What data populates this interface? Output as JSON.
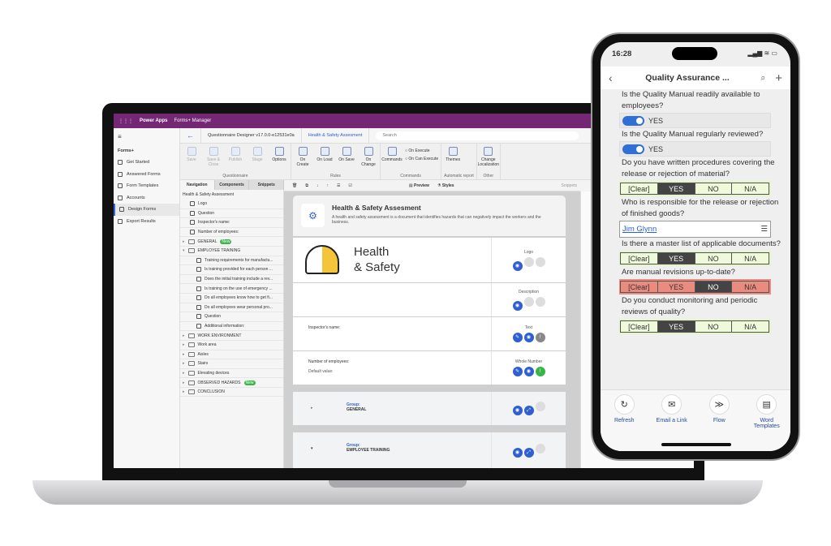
{
  "laptop": {
    "app_name": "Power Apps",
    "app_section": "Forms+ Manager",
    "nav_title": "Forms+",
    "nav_items": [
      {
        "label": "Get Started"
      },
      {
        "label": "Answered Forms"
      },
      {
        "label": "Form Templates"
      },
      {
        "label": "Accounts"
      },
      {
        "label": "Design Forms",
        "active": true
      },
      {
        "label": "Export Results"
      }
    ],
    "header": {
      "designer": "Questionnaire Designer v17.0.0-e12531e0a",
      "form": "Health & Safety Assesment",
      "search_placeholder": "Search"
    },
    "ribbon": {
      "questionnaire": {
        "label": "Questionnaire",
        "buttons": [
          "Save",
          "Save & Close",
          "Publish",
          "Stage",
          "Options"
        ]
      },
      "rules": {
        "label": "Rules",
        "buttons": [
          "On Create",
          "On Load",
          "On Save",
          "On Change"
        ]
      },
      "commands": {
        "label": "Commands",
        "buttons": [
          "Commands"
        ],
        "options": [
          "On Execute",
          "On Can Execute"
        ]
      },
      "automatic_report": {
        "label": "Automatic report",
        "buttons": [
          "Themes"
        ]
      },
      "other": {
        "label": "Other",
        "buttons": [
          "Change Localization"
        ]
      }
    },
    "tabs": [
      "Navigation",
      "Components",
      "Snippets"
    ],
    "toolbar": {
      "preview": "Preview",
      "styles": "Styles",
      "snippets": "Snippets"
    },
    "tree": {
      "root": "Health & Safety Assessment",
      "items": [
        {
          "label": "Logo",
          "level": 1
        },
        {
          "label": "Question",
          "level": 1
        },
        {
          "label": "Inspector's name:",
          "level": 1
        },
        {
          "label": "Number of employees:",
          "level": 1
        },
        {
          "label": "GENERAL",
          "level": 0,
          "badge": "New"
        },
        {
          "label": "EMPLOYEE TRAINING",
          "level": 0,
          "expanded": true
        },
        {
          "label": "Training requirements for manufactu...",
          "level": 2
        },
        {
          "label": "Is training provided for each person ...",
          "level": 2
        },
        {
          "label": "Does the initial training include a rev...",
          "level": 2
        },
        {
          "label": "Is training on the use of emergency ...",
          "level": 2
        },
        {
          "label": "Do all employees know how to get fi...",
          "level": 2
        },
        {
          "label": "Do all employees wear personal pro...",
          "level": 2
        },
        {
          "label": "Question",
          "level": 2
        },
        {
          "label": "Additional information:",
          "level": 2
        },
        {
          "label": "WORK ENVIRONMENT",
          "level": 0
        },
        {
          "label": "Work area",
          "level": 0
        },
        {
          "label": "Aisles",
          "level": 0
        },
        {
          "label": "Stairs",
          "level": 0
        },
        {
          "label": "Elevating devices",
          "level": 0
        },
        {
          "label": "OBSERVED HAZARDS",
          "level": 0,
          "badge": "New"
        },
        {
          "label": "CONCLUSION",
          "level": 0
        }
      ]
    },
    "form": {
      "title": "Health & Safety Assesment",
      "description": "A health and safety assessment is a document that identifies hazards that can negatively impact the workers and the business.",
      "logo_line1": "Health",
      "logo_line2": "& Safety",
      "rows": [
        {
          "type": "Logo"
        },
        {
          "type": "Description"
        },
        {
          "label": "Inspector's name:",
          "type": "Text"
        },
        {
          "label": "Number of employees:",
          "sub": "Default value:",
          "type": "Whole Number"
        }
      ],
      "groups": [
        {
          "prefix": "Group:",
          "name": "GENERAL"
        },
        {
          "prefix": "Group:",
          "name": "EMPLOYEE TRAINING"
        }
      ]
    }
  },
  "phone": {
    "time": "16:28",
    "title": "Quality Assurance ...",
    "questions": [
      {
        "text": "Is the Quality Manual readily available to employees?",
        "kind": "toggle",
        "value": "YES"
      },
      {
        "text": "Is the Quality Manual regularly reviewed?",
        "kind": "toggle",
        "value": "YES"
      },
      {
        "text": "Do you have written procedures covering the release or rejection of material?",
        "kind": "choice",
        "value": "YES"
      },
      {
        "text": "Who is responsible for the release or rejection of finished goods?",
        "kind": "lookup",
        "value": "Jim Glynn"
      },
      {
        "text": "Is there a master list of applicable documents?",
        "kind": "choice",
        "value": "YES"
      },
      {
        "text": "Are manual revisions up-to-date?",
        "kind": "choice",
        "value": "NO"
      },
      {
        "text": "Do you conduct monitoring and periodic reviews of quality?",
        "kind": "choice",
        "value": "YES"
      }
    ],
    "choice_options": [
      "[Clear]",
      "YES",
      "NO",
      "N/A"
    ],
    "bottom": [
      "Refresh",
      "Email a Link",
      "Flow",
      "Word Templates"
    ]
  },
  "colors": {
    "brand": "#742774",
    "accent": "#2f5fd0",
    "ok": "#e3f5c9",
    "bad": "#e98c7f"
  }
}
